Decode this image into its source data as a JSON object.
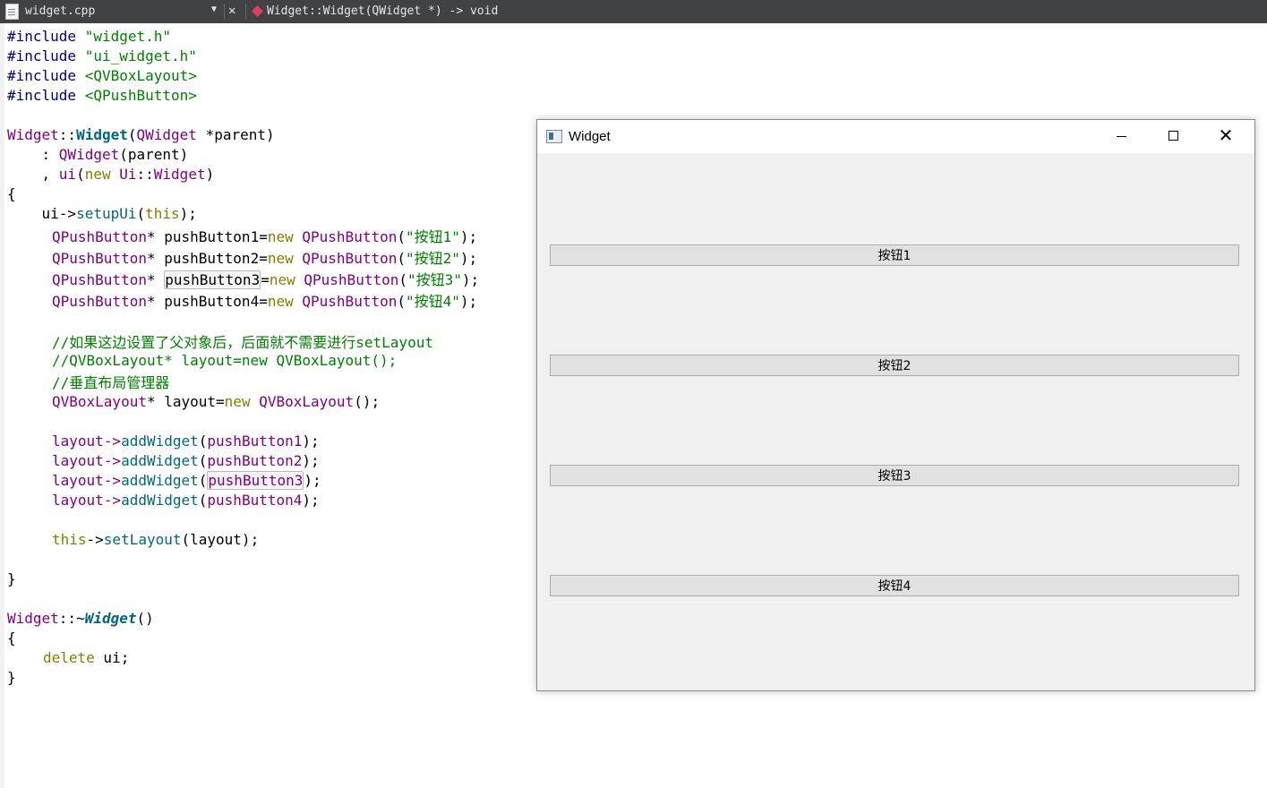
{
  "editor": {
    "filename": "widget.cpp",
    "symbol": "Widget::Widget(QWidget *) -> void",
    "lines": {
      "l1a": "#include ",
      "l1b": "\"widget.h\"",
      "l2a": "#include ",
      "l2b": "\"ui_widget.h\"",
      "l3a": "#include ",
      "l3b": "<QVBoxLayout>",
      "l4a": "#include ",
      "l4b": "<QPushButton>",
      "ctor_class": "Widget",
      "ctor_sep": "::",
      "ctor_name": "Widget",
      "ctor_paren": "(",
      "ctor_type": "QWidget",
      "ctor_param": " *parent)",
      "init1a": "    : ",
      "init1b": "QWidget",
      "init1c": "(parent)",
      "init2a": "    , ",
      "init2b": "ui",
      "init2c": "(",
      "init2d": "new",
      "init2e": " ",
      "init2f": "Ui",
      "init2g": "::",
      "init2h": "Widget",
      "init2i": ")",
      "brace_open": "{",
      "setup_a": "    ui->",
      "setup_b": "setupUi",
      "setup_c": "(",
      "setup_d": "this",
      "setup_e": ");",
      "pb_type": "QPushButton",
      "pb1_var": "pushButton1",
      "pb2_var": "pushButton2",
      "pb3_var": "pushButton3",
      "pb4_var": "pushButton4",
      "pb_new": "new",
      "pb1_str": "\"按钮1\"",
      "pb2_str": "\"按钮2\"",
      "pb3_str": "\"按钮3\"",
      "pb4_str": "\"按钮4\"",
      "comment1": "//如果这边设置了父对象后，后面就不需要进行setLayout",
      "comment2": "//QVBoxLayout* layout=new QVBoxLayout();",
      "comment3": "//垂直布局管理器",
      "lay_type": "QVBoxLayout",
      "lay_var": "* layout=",
      "lay_new": "new",
      "lay_call": "();",
      "add_obj": "layout->",
      "add_fn": "addWidget",
      "this_kw": "this",
      "setl_arrow": "->",
      "setl_fn": "setLayout",
      "setl_arg": "(layout);",
      "brace_close": "}",
      "dtor_class": "Widget",
      "dtor_sep": "::~",
      "dtor_name": "Widget",
      "dtor_paren": "()",
      "del_kw": "delete",
      "del_rest": " ui;"
    }
  },
  "window": {
    "title": "Widget",
    "minimize_label": "",
    "maximize_label": "",
    "close_label": "✕",
    "buttons": [
      "按钮1",
      "按钮2",
      "按钮3",
      "按钮4"
    ]
  }
}
